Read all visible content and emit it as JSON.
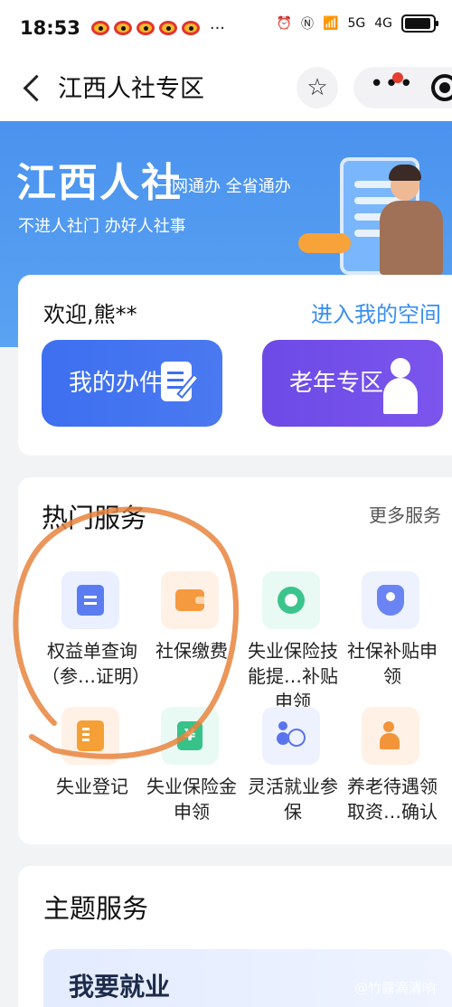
{
  "status_bar": {
    "time": "18:53",
    "more": "···",
    "network_5g": "5G",
    "network_4g": "4G"
  },
  "navbar": {
    "title": "江西人社专区"
  },
  "banner": {
    "logo": "江西人社",
    "slogan": "一网通办 全省通办",
    "sub_slogan": "不进人社门 办好人社事"
  },
  "welcome": {
    "greeting": "欢迎,熊**",
    "space_link": "进入我的空间",
    "my_affairs": "我的办件",
    "elderly_zone": "老年专区"
  },
  "hot_services": {
    "title": "热门服务",
    "more": "更多服务",
    "items": [
      {
        "label": "权益单查询（参…证明）",
        "icon": "clipboard-icon"
      },
      {
        "label": "社保缴费",
        "icon": "wallet-icon"
      },
      {
        "label": "失业保险技能提…补贴申领",
        "icon": "medal-icon"
      },
      {
        "label": "社保补贴申领",
        "icon": "shield-user-icon"
      },
      {
        "label": "失业登记",
        "icon": "id-card-icon"
      },
      {
        "label": "失业保险金申领",
        "icon": "yen-shield-icon"
      },
      {
        "label": "灵活就业参保",
        "icon": "person-yen-icon"
      },
      {
        "label": "养老待遇领取资…确认",
        "icon": "elder-icon"
      }
    ]
  },
  "theme_services": {
    "title": "主题服务",
    "job": "我要就业"
  },
  "watermark": "@竹露滴清响",
  "colors": {
    "brand_blue": "#4a92ee",
    "accent_blue": "#3a8ef0",
    "button_blue": "#3d6ff0",
    "button_purple": "#6d4ae6",
    "annotation": "#e8843d"
  }
}
